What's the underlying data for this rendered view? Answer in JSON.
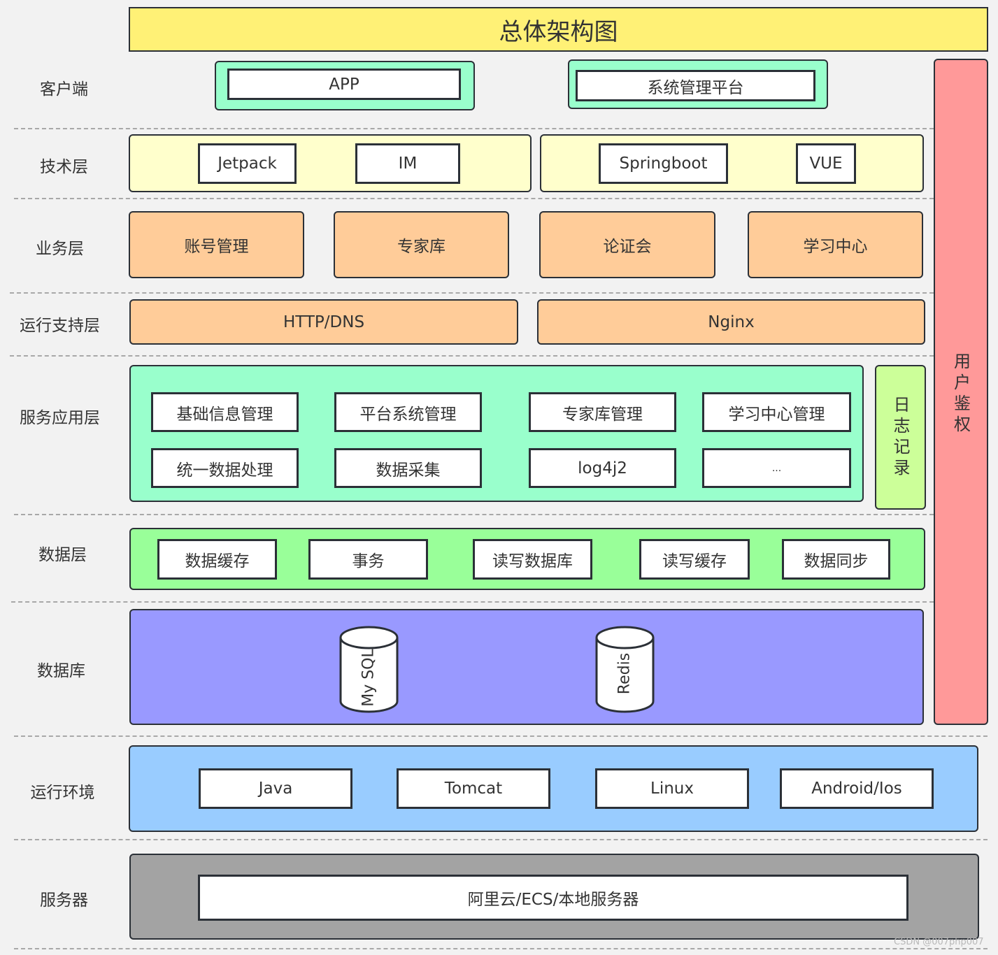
{
  "title": "总体架构图",
  "layers": [
    {
      "label": "客户端",
      "items": [
        "APP",
        "系统管理平台"
      ]
    },
    {
      "label": "技术层",
      "items": [
        "Jetpack",
        "IM",
        "Springboot",
        "VUE"
      ]
    },
    {
      "label": "业务层",
      "items": [
        "账号管理",
        "专家库",
        "论证会",
        "学习中心"
      ]
    },
    {
      "label": "运行支持层",
      "items": [
        "HTTP/DNS",
        "Nginx"
      ]
    },
    {
      "label": "服务应用层",
      "items": [
        "基础信息管理",
        "平台系统管理",
        "专家库管理",
        "学习中心管理",
        "统一数据处理",
        "数据采集",
        "log4j2",
        "..."
      ]
    },
    {
      "label": "数据层",
      "items": [
        "数据缓存",
        "事务",
        "读写数据库",
        "读写缓存",
        "数据同步"
      ]
    },
    {
      "label": "数据库",
      "items": [
        "My SQL",
        "Redis"
      ]
    },
    {
      "label": "运行环境",
      "items": [
        "Java",
        "Tomcat",
        "Linux",
        "Android/Ios"
      ]
    },
    {
      "label": "服务器",
      "items": [
        "阿里云/ECS/本地服务器"
      ]
    }
  ],
  "side_bars": {
    "logging": "日志记录",
    "auth": "用户鉴权"
  },
  "colors": {
    "title_bg": "#fff176",
    "client_bg": "#99ffcc",
    "tech_bg": "#ffffcc",
    "business_bg": "#ffcc99",
    "service_bg": "#99ffcc",
    "data_bg": "#99ff99",
    "db_bg": "#9999ff",
    "runtime_bg": "#99ccff",
    "server_bg": "#a3a3a3",
    "log_bg": "#ccff99",
    "auth_bg": "#ff9999"
  },
  "watermark": "CSDN @007php007"
}
